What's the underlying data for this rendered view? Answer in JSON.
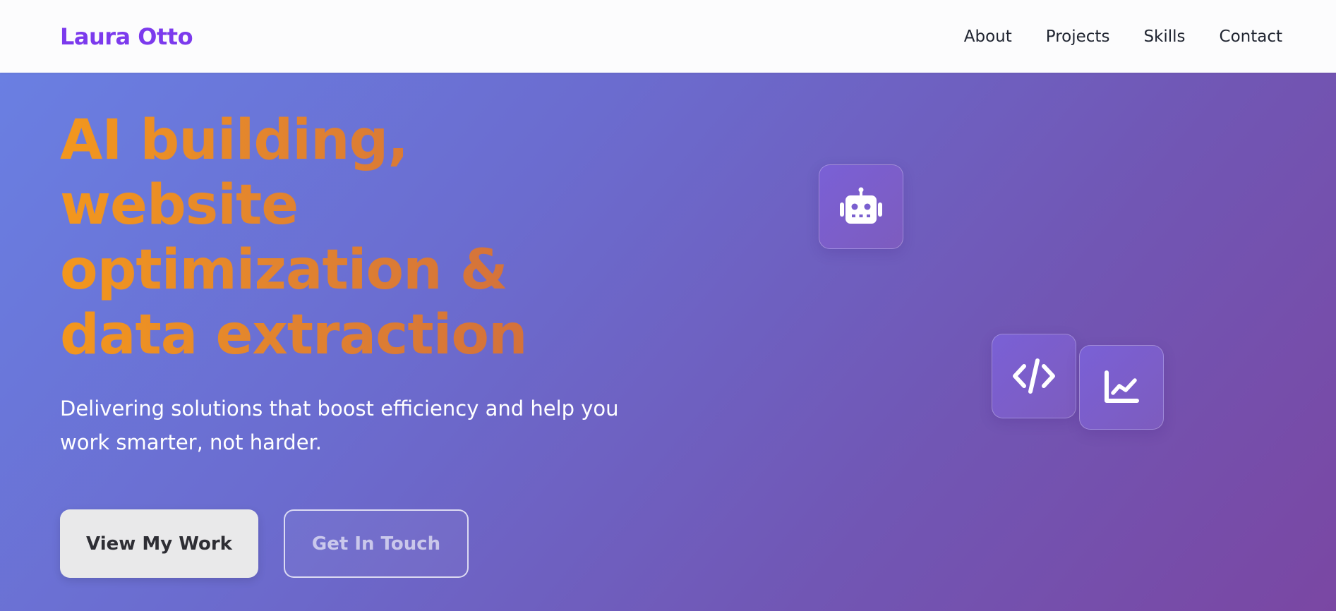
{
  "brand": {
    "name": "Laura Otto"
  },
  "nav": {
    "items": [
      {
        "label": "About"
      },
      {
        "label": "Projects"
      },
      {
        "label": "Skills"
      },
      {
        "label": "Contact"
      }
    ]
  },
  "hero": {
    "headline_lines": [
      "AI building,",
      "website",
      "optimization &",
      "data extraction"
    ],
    "subtitle_lines": [
      "Delivering solutions that boost efficiency and help you",
      "work smarter, not harder."
    ],
    "primary_button": "View My Work",
    "secondary_button": "Get In Touch",
    "icons": [
      "robot-icon",
      "code-icon",
      "line-chart-icon"
    ]
  },
  "colors": {
    "brand": "#7c3aed",
    "headline_gradient_start": "#f3971d",
    "headline_gradient_end": "#cf6c3f",
    "hero_gradient_start": "#6a7fe2",
    "hero_gradient_end": "#7a47a3"
  }
}
